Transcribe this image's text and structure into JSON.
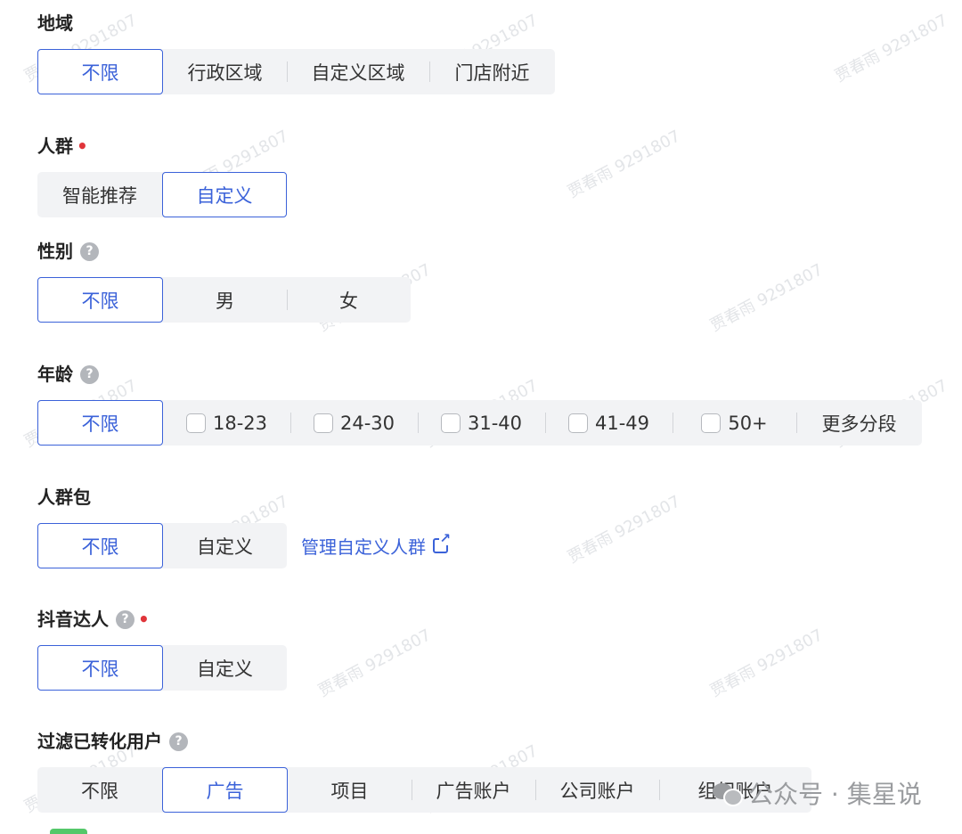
{
  "region": {
    "label": "地域",
    "options": [
      "不限",
      "行政区域",
      "自定义区域",
      "门店附近"
    ]
  },
  "audience": {
    "label": "人群",
    "required": "•",
    "options": [
      "智能推荐",
      "自定义"
    ]
  },
  "gender": {
    "label": "性别",
    "help": "?",
    "options": [
      "不限",
      "男",
      "女"
    ]
  },
  "age": {
    "label": "年龄",
    "help": "?",
    "options": [
      "不限",
      "18-23",
      "24-30",
      "31-40",
      "41-49",
      "50+",
      "更多分段"
    ]
  },
  "audience_pack": {
    "label": "人群包",
    "options": [
      "不限",
      "自定义"
    ],
    "manage_link": "管理自定义人群"
  },
  "douyin_influencer": {
    "label": "抖音达人",
    "help": "?",
    "required": "•",
    "options": [
      "不限",
      "自定义"
    ]
  },
  "filter_converted": {
    "label": "过滤已转化用户",
    "help": "?",
    "options": [
      "不限",
      "广告",
      "项目",
      "广告账户",
      "公司账户",
      "组织账户"
    ]
  },
  "watermark": {
    "text": "贾春雨 9291807",
    "brand": "公众号 · 集星说"
  },
  "colors": {
    "accent": "#3b62d9",
    "required": "#e0353a",
    "segment_bg": "#f2f3f5"
  }
}
